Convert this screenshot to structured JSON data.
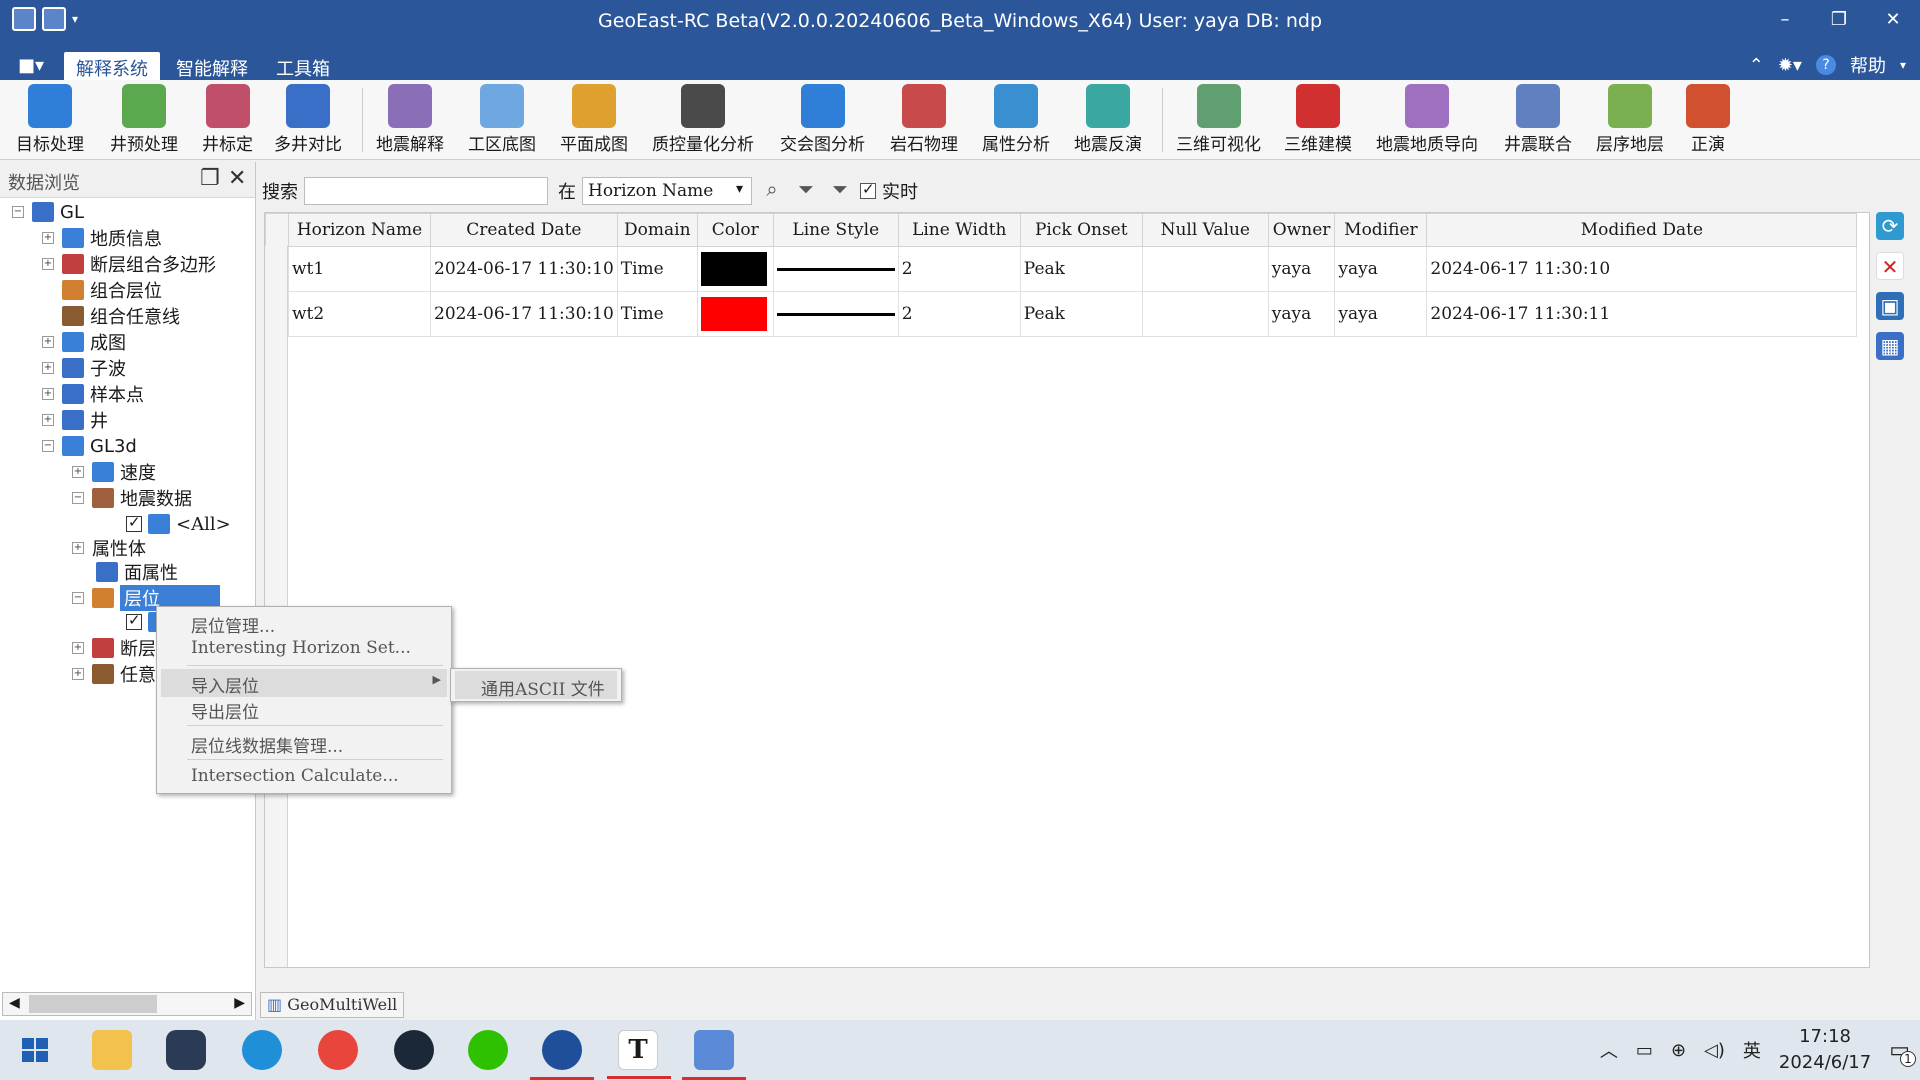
{
  "window": {
    "title": "GeoEast-RC Beta(V2.0.0.20240606_Beta_Windows_X64)   User: yaya    DB: ndp",
    "minimize": "–",
    "restore": "❐",
    "close": "✕"
  },
  "menubar": {
    "home": "■▾",
    "tabs": [
      "解释系统",
      "智能解释",
      "工具箱"
    ],
    "help": "帮助"
  },
  "ribbon": {
    "items": [
      {
        "label": "目标处理",
        "color": "#2f7fd8"
      },
      {
        "label": "井预处理",
        "color": "#5ba84f"
      },
      {
        "label": "井标定",
        "color": "#c0506a"
      },
      {
        "label": "多井对比",
        "color": "#3a6fc8"
      },
      {
        "label": "地震解释",
        "color": "#8a6fb8"
      },
      {
        "label": "工区底图",
        "color": "#6fa8e0"
      },
      {
        "label": "平面成图",
        "color": "#e0a030"
      },
      {
        "label": "质控量化分析",
        "color": "#4a4a4a"
      },
      {
        "label": "交会图分析",
        "color": "#2f7fd8"
      },
      {
        "label": "岩石物理",
        "color": "#c84a4a"
      },
      {
        "label": "属性分析",
        "color": "#3a8fd0"
      },
      {
        "label": "地震反演",
        "color": "#3aa8a0"
      },
      {
        "label": "三维可视化",
        "color": "#60a070"
      },
      {
        "label": "三维建模",
        "color": "#d03030"
      },
      {
        "label": "地震地质导向",
        "color": "#a070c0"
      },
      {
        "label": "井震联合",
        "color": "#6080c0"
      },
      {
        "label": "层序地层",
        "color": "#7ab050"
      },
      {
        "label": "正演",
        "color": "#d05030"
      }
    ]
  },
  "leftpanel": {
    "title": "数据浏览",
    "tree": [
      {
        "label": "GL",
        "color": "#3a6fc8"
      },
      {
        "label": "地质信息",
        "color": "#3a7fd8"
      },
      {
        "label": "断层组合多边形",
        "color": "#c04040"
      },
      {
        "label": "组合层位",
        "color": "#d08030"
      },
      {
        "label": "组合任意线",
        "color": "#8a5a30"
      },
      {
        "label": "成图",
        "color": "#3a7fd8"
      },
      {
        "label": "子波",
        "color": "#3a6fc8"
      },
      {
        "label": "样本点",
        "color": "#3a6fc8"
      },
      {
        "label": "井",
        "color": "#3a6fc8"
      },
      {
        "label": "GL3d",
        "color": "#3a7fd8"
      },
      {
        "label": "速度",
        "color": "#3a7fd8"
      },
      {
        "label": "地震数据",
        "color": "#a06040"
      },
      {
        "label": "<All>",
        "color": "#3a7fd8"
      },
      {
        "label": "属性体",
        "color": "#3a7fd8"
      },
      {
        "label": "面属性",
        "color": "#3a6fc8"
      },
      {
        "label": "层位",
        "color": "#d08030"
      },
      {
        "label": "",
        "color": "#3a7fd8"
      },
      {
        "label": "断层",
        "color": "#c04040"
      },
      {
        "label": "任意",
        "color": "#8a5a30"
      }
    ]
  },
  "search": {
    "label": "搜索",
    "value": "",
    "in_label": "在",
    "field": "Horizon Name",
    "realtime": "实时"
  },
  "table": {
    "columns": [
      "Horizon Name",
      "Created Date",
      "Domain",
      "Color",
      "Line Style",
      "Line Width",
      "Pick Onset",
      "Null Value",
      "Owner",
      "Modifier",
      "Modified Date"
    ],
    "rows": [
      {
        "index": "1",
        "name": "wt1",
        "created": "2024-06-17 11:30:10",
        "domain": "Time",
        "color": "#000000",
        "line_width": "2",
        "pick_onset": "Peak",
        "null_value": "",
        "owner": "yaya",
        "modifier": "yaya",
        "modified": "2024-06-17 11:30:10"
      },
      {
        "index": "2",
        "name": "wt2",
        "created": "2024-06-17 11:30:10",
        "domain": "Time",
        "color": "#ff0000",
        "line_width": "2",
        "pick_onset": "Peak",
        "null_value": "",
        "owner": "yaya",
        "modifier": "yaya",
        "modified": "2024-06-17 11:30:11"
      }
    ]
  },
  "context_menu": {
    "items": [
      "层位管理...",
      "Interesting Horizon Set...",
      "导入层位",
      "导出层位",
      "层位线数据集管理...",
      "Intersection Calculate..."
    ],
    "submenu": "通用ASCII 文件"
  },
  "bottom_tab": "GeoMultiWell",
  "taskbar": {
    "time": "17:18",
    "date": "2024/6/17",
    "ime": "英",
    "notify": "1"
  }
}
